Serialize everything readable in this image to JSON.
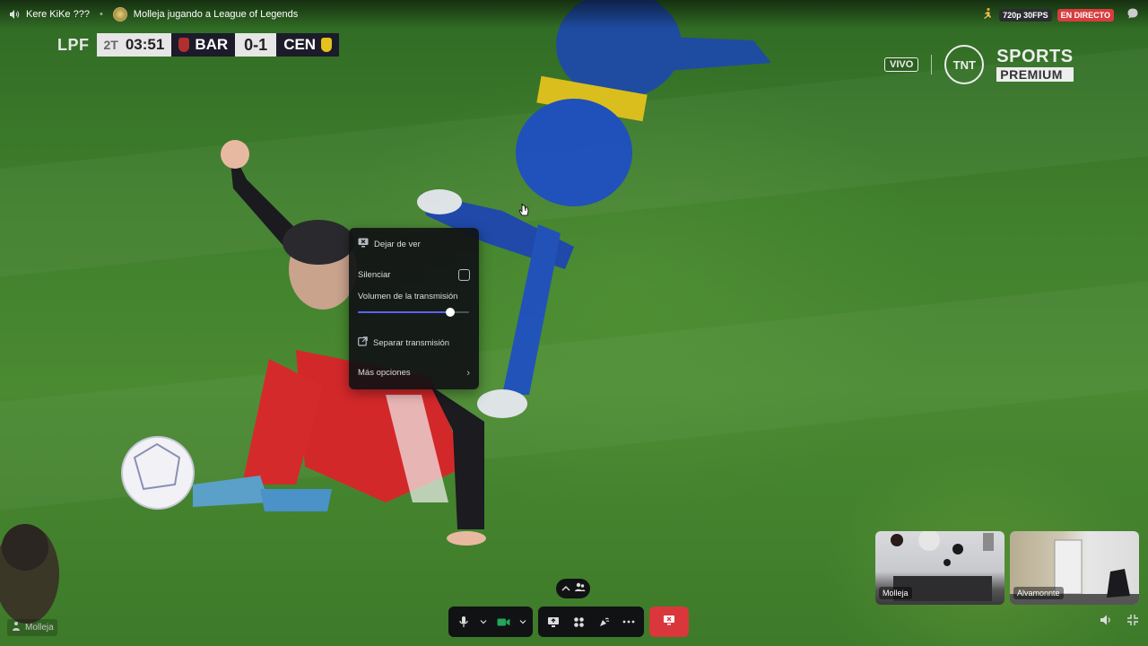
{
  "header": {
    "channel_name": "Kere KiKe ???",
    "separator": "•",
    "activity": "Molleja jugando a League of Legends",
    "quality": "720p 30FPS",
    "live_badge": "EN DIRECTO"
  },
  "stream": {
    "scoreboard": {
      "league": "LPF",
      "half": "2T",
      "clock": "03:51",
      "home_team": "BAR",
      "score": "0-1",
      "away_team": "CEN"
    },
    "broadcaster": {
      "live_tag": "VIVO",
      "logo": "TNT",
      "sports": "SPORTS",
      "premium": "PREMIUM"
    }
  },
  "context_menu": {
    "stop_watching": "Dejar de ver",
    "mute": "Silenciar",
    "mute_checked": false,
    "volume_label": "Volumen de la transmisión",
    "volume_level": 0.83,
    "pop_out": "Separar transmisión",
    "more_options": "Más opciones"
  },
  "participants": [
    {
      "name": "Molleja"
    },
    {
      "name": "Alvamonnte"
    }
  ],
  "self_label": "Molleja",
  "colors": {
    "accent": "#5865f2",
    "danger": "#da373c",
    "live": "#d83c3e",
    "camera_active": "#23a55a"
  },
  "icons": [
    "speaker-icon",
    "activity-icon",
    "person-run-icon",
    "chat-icon",
    "screen-stop-icon",
    "checkbox-icon",
    "popout-icon",
    "chevron-right-icon",
    "microphone-icon",
    "camera-icon",
    "share-screen-icon",
    "activities-icon",
    "soundboard-icon",
    "more-icon",
    "hangup-icon",
    "volume-icon",
    "collapse-fullscreen-icon"
  ]
}
